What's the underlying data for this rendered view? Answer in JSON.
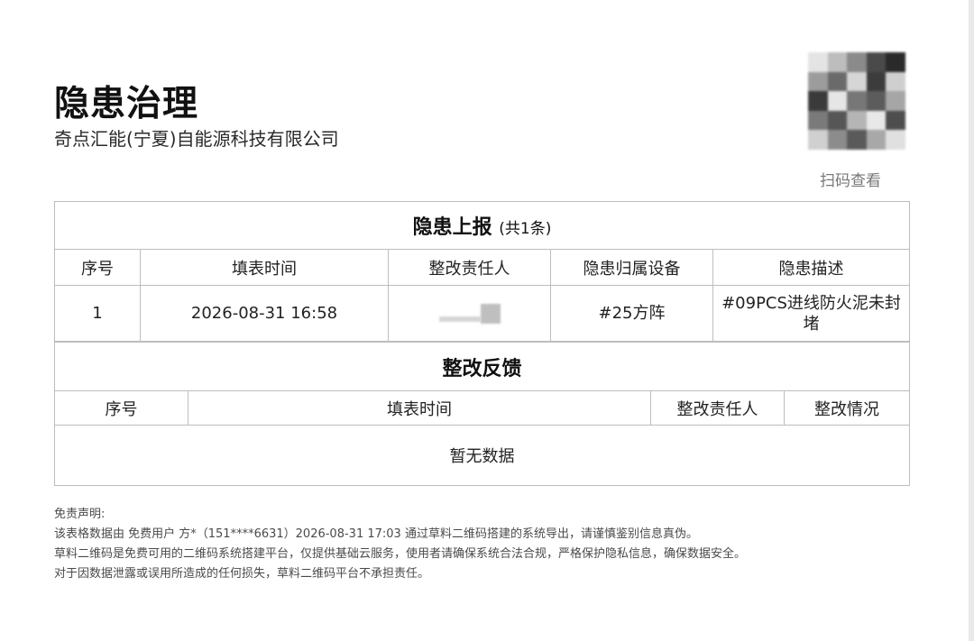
{
  "header": {
    "title": "隐患治理",
    "company": "奇点汇能(宁夏)自能源科技有限公司",
    "scan_label": "扫码查看"
  },
  "report_section": {
    "title": "隐患上报",
    "count": "(共1条)",
    "columns": [
      "序号",
      "填表时间",
      "整改责任人",
      "隐患归属设备",
      "隐患描述"
    ],
    "rows": [
      {
        "index": "1",
        "time": "2026-08-31 16:58",
        "device": "#25方阵",
        "description": "#09PCS进线防火泥未封堵"
      }
    ]
  },
  "feedback_section": {
    "title": "整改反馈",
    "columns": [
      "序号",
      "填表时间",
      "整改责任人",
      "整改情况"
    ],
    "empty_text": "暂无数据"
  },
  "disclaimer": {
    "heading": "免责声明:",
    "lines": [
      "该表格数据由 免费用户 方*（151****6631）2026-08-31 17:03 通过草料二维码搭建的系统导出，请谨慎鉴别信息真伪。",
      "草料二维码是免费可用的二维码系统搭建平台，仅提供基础云服务，使用者请确保系统合法合规，严格保护隐私信息，确保数据安全。",
      "对于因数据泄露或误用所造成的任何损失，草料二维码平台不承担责任。"
    ]
  },
  "colors": {
    "border": "#bdbdbd",
    "text": "#1a1a1a",
    "muted": "#777777"
  }
}
